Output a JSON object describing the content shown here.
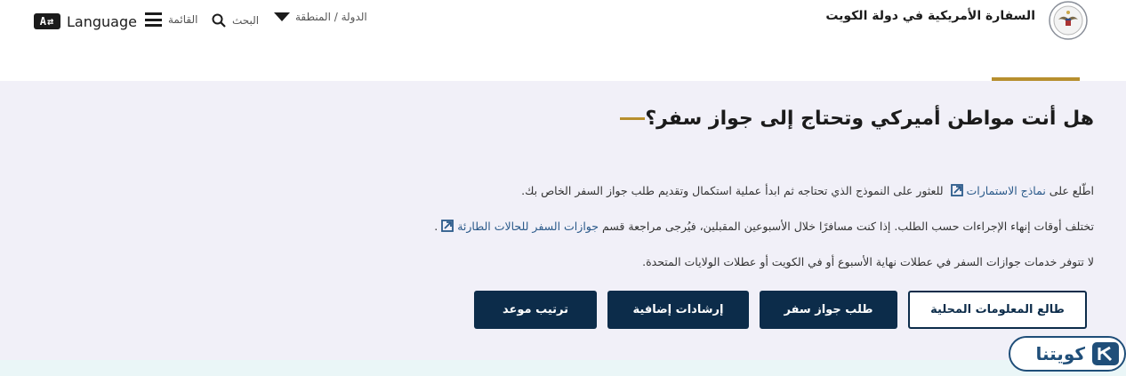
{
  "header": {
    "embassy_name": "السفارة الأمريكية في دولة الكويت",
    "language_icon": "A⇄",
    "language_label": "Language",
    "menu_label": "القائمة",
    "search_label": "البحث",
    "country_label": "الدولة / المنطقة",
    "seal_icon": "us-embassy-seal-icon"
  },
  "main": {
    "heading": "هل أنت مواطن أميركي وتحتاج إلى جواز سفر؟",
    "p1_before": "اطّلع على ",
    "p1_link": "نماذج الاستمارات",
    "p1_after": " للعثور على النموذج الذي تحتاجه ثم ابدأ عملية استكمال وتقديم طلب جواز السفر الخاص بك.",
    "p2_before": "تختلف أوقات إنهاء الإجراءات حسب الطلب. إذا كنت مسافرًا خلال الأسبوعين المقبلين، فيُرجى مراجعة قسم ",
    "p2_link": "جوازات السفر للحالات الطارئة",
    "p2_after": ".",
    "p3": "لا تتوفر خدمات جوازات السفر في عطلات نهاية الأسبوع أو في الكويت أو عطلات الولايات المتحدة.",
    "buttons": {
      "local_info": "طالع المعلومات المحلية",
      "apply_passport": "طلب جواز سفر",
      "more_guidance": "إرشادات إضافية",
      "schedule": "ترتيب موعد"
    }
  },
  "watermark": {
    "text": "كويتنا"
  },
  "colors": {
    "navy": "#0c2c4a",
    "gold": "#b78f2e",
    "band": "#f1f0f8",
    "link": "#2b5a8a"
  }
}
